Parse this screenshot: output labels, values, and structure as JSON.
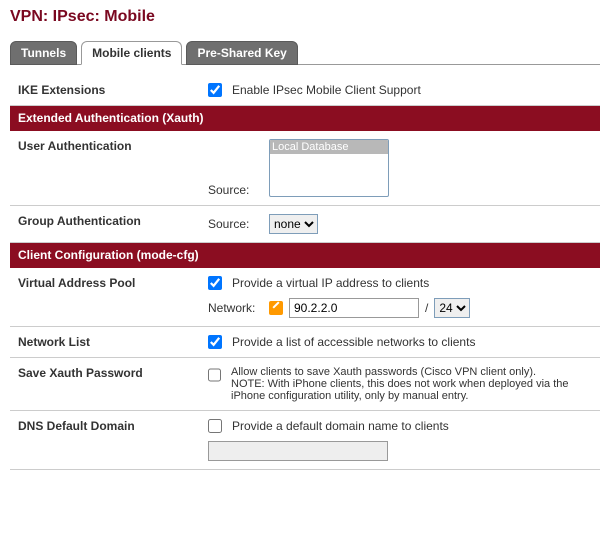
{
  "page_title": "VPN: IPsec: Mobile",
  "tabs": {
    "tunnels": "Tunnels",
    "mobile_clients": "Mobile clients",
    "psk": "Pre-Shared Key"
  },
  "rows": {
    "ike_ext": {
      "label": "IKE Extensions",
      "check_label": "Enable IPsec Mobile Client Support"
    },
    "xauth_header": "Extended Authentication (Xauth)",
    "user_auth": {
      "label": "User Authentication",
      "source_label": "Source:",
      "option0": "Local Database"
    },
    "group_auth": {
      "label": "Group Authentication",
      "source_label": "Source:",
      "selected": "none"
    },
    "modecfg_header": "Client Configuration (mode-cfg)",
    "vap": {
      "label": "Virtual Address Pool",
      "check_label": "Provide a virtual IP address to clients",
      "network_label": "Network:",
      "network_value": "90.2.2.0",
      "slash": "/",
      "mask": "24"
    },
    "netlist": {
      "label": "Network List",
      "check_label": "Provide a list of accessible networks to clients"
    },
    "savexauth": {
      "label": "Save Xauth Password",
      "line1": "Allow clients to save Xauth passwords (Cisco VPN client only).",
      "line2": "NOTE: With iPhone clients, this does not work when deployed via the iPhone configuration utility, only by manual entry."
    },
    "dns": {
      "label": "DNS Default Domain",
      "check_label": "Provide a default domain name to clients",
      "value": ""
    }
  }
}
